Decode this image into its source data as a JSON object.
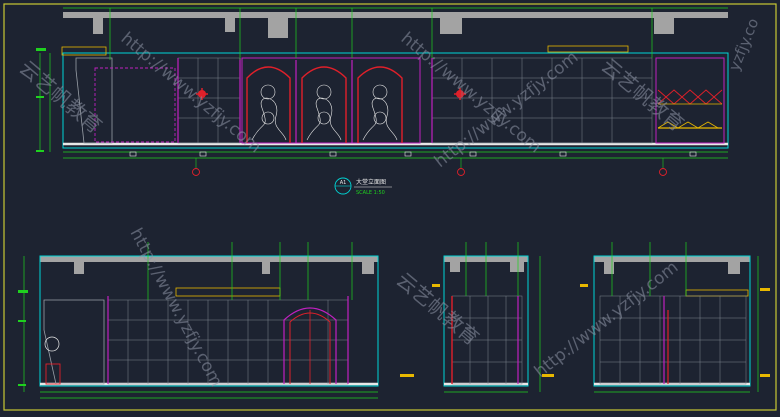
{
  "drawing": {
    "title_tag": "A1",
    "title_main": "大堂立面图",
    "title_scale": "SCALE 1:50",
    "axis_marks": [
      "①",
      "②",
      "③"
    ],
    "watermark_url": "http://www.yzfjy.com",
    "watermark_cn": "云艺帆教育",
    "watermark_top_right": "yzfjy.co"
  },
  "colors": {
    "background": "#1d2331",
    "frame": "#c8c832",
    "wall_line": "#00d6d6",
    "dimension": "#1fd11f",
    "magenta": "#c020c0",
    "red": "#e0202a",
    "white": "#e8e8e8",
    "ceiling_fill": "#a3a3a3",
    "watermark": "#8e96a6"
  }
}
